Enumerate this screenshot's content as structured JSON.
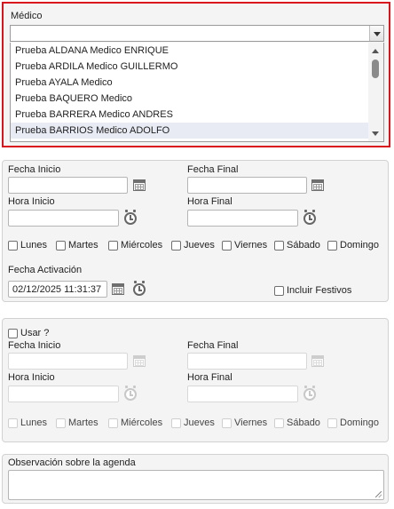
{
  "medico": {
    "label": "Médico",
    "selected_value": "",
    "options": [
      "Prueba ALDANA Medico ENRIQUE",
      "Prueba ARDILA Medico GUILLERMO",
      "Prueba AYALA Medico",
      "Prueba BAQUERO Medico",
      "Prueba BARRERA Medico ANDRES",
      "Prueba BARRIOS Medico ADOLFO"
    ],
    "highlighted_option": "Prueba BARRIOS Medico ADOLFO"
  },
  "schedule1": {
    "fecha_inicio_label": "Fecha Inicio",
    "fecha_final_label": "Fecha Final",
    "hora_inicio_label": "Hora Inicio",
    "hora_final_label": "Hora Final",
    "fecha_inicio_value": "",
    "fecha_final_value": "",
    "hora_inicio_value": "",
    "hora_final_value": "",
    "days": [
      "Lunes",
      "Martes",
      "Miércoles",
      "Jueves",
      "Viernes",
      "Sábado",
      "Domingo"
    ],
    "fecha_activacion_label": "Fecha Activación",
    "fecha_activacion_value": "02/12/2025 11:31:37",
    "incluir_festivos_label": "Incluir Festivos"
  },
  "schedule2": {
    "usar_label": "Usar ?",
    "fecha_inicio_label": "Fecha Inicio",
    "fecha_final_label": "Fecha Final",
    "hora_inicio_label": "Hora Inicio",
    "hora_final_label": "Hora Final",
    "fecha_inicio_value": "",
    "fecha_final_value": "",
    "hora_inicio_value": "",
    "hora_final_value": "",
    "days": [
      "Lunes",
      "Martes",
      "Miércoles",
      "Jueves",
      "Viernes",
      "Sábado",
      "Domingo"
    ]
  },
  "observacion": {
    "label": "Observación sobre la agenda",
    "value": ""
  },
  "colors": {
    "highlight_border": "#d9141c",
    "panel_bg": "#f4f4f4",
    "list_hover": "#e8ebf4"
  },
  "icons": [
    "calendar-icon",
    "clock-icon",
    "dropdown-arrow-icon",
    "resize-grip-icon"
  ]
}
